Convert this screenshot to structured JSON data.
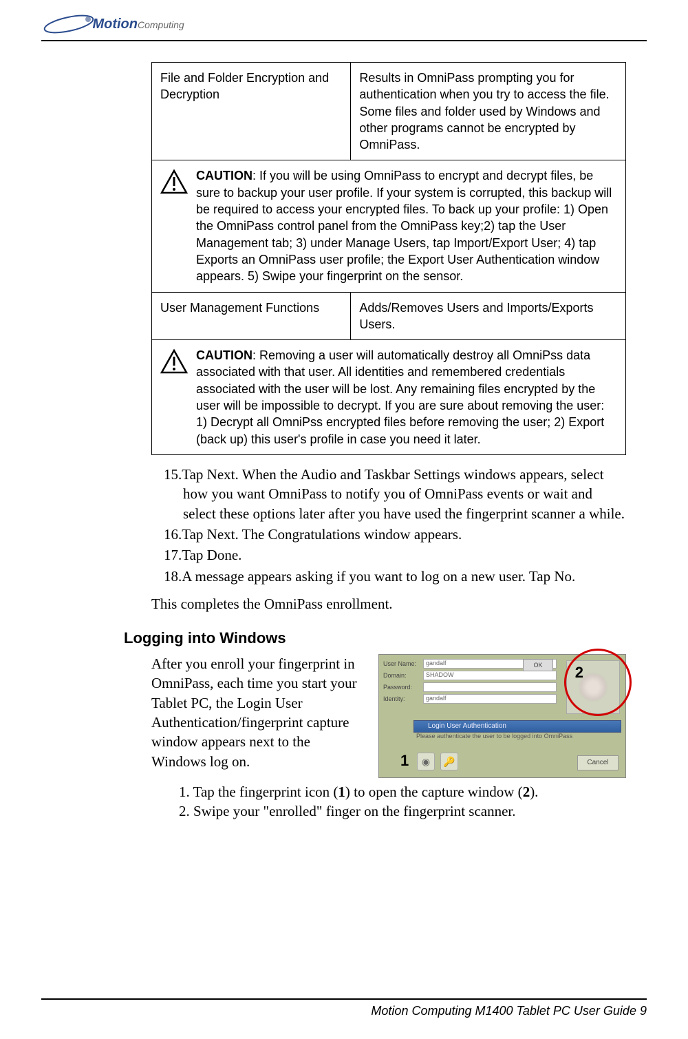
{
  "brand": {
    "name_motion": "Motion",
    "name_computing": "Computing"
  },
  "table": {
    "row1": {
      "left": "File and Folder Encryption and Decryption",
      "right": "Results in OmniPass prompting you for authentication when you try to access the file. Some files and folder used by Windows and other programs cannot be encrypted by OmniPass."
    },
    "caution1": {
      "label": "CAUTION",
      "text": ": If you will be using OmniPass to encrypt and decrypt files, be sure to backup your user profile. If your system is corrupted, this backup will be required to access your encrypted files. To back up your profile: 1) Open the OmniPass control panel from the OmniPass key;2) tap the User Management tab; 3) under Manage Users, tap Import/Export User; 4) tap Exports an OmniPass user profile; the Export User Authentication window appears. 5) Swipe your fingerprint on the sensor."
    },
    "row2": {
      "left": "User Management Functions",
      "right": "Adds/Removes Users and Imports/Exports Users."
    },
    "caution2": {
      "label": "CAUTION",
      "text": ": Removing a user will automatically destroy all OmniPss data associated with that user. All identities and remembered credentials associated with the user will be lost. Any remaining files encrypted by the user will be impossible to decrypt. If you are sure about removing the user: 1) Decrypt all OmniPss encrypted files before removing the user; 2) Export (back up) this user's profile in case you need it later."
    }
  },
  "steps": {
    "s15": "15.Tap Next. When the Audio and Taskbar Settings windows appears, select how you want OmniPass to notify you of OmniPass events or wait and select these options later after you have used the fingerprint scanner a while.",
    "s16": "16.Tap Next. The Congratulations window appears.",
    "s17": "17.Tap Done.",
    "s18": "18.A message appears asking if you want to log on a new user. Tap No."
  },
  "closing": "This completes the OmniPass enrollment.",
  "section_heading": "Logging into Windows",
  "login_para": "After you enroll your fingerprint in OmniPass, each time you start your Tablet PC, the Login User Authentication/fingerprint capture window appears next to the Windows log on.",
  "login_mock": {
    "user_label": "User Name:",
    "user_value": "gandalf",
    "domain_label": "Domain:",
    "domain_value": "SHADOW",
    "password_label": "Password:",
    "identity_label": "Identity:",
    "identity_value": "gandalf",
    "ok": "OK",
    "auth_title": "Login User Authentication",
    "auth_sub": "Please authenticate the user to be logged into OmniPass",
    "cancel": "Cancel"
  },
  "callouts": {
    "num1": "1",
    "num2": "2"
  },
  "sub_steps": {
    "s1a": "1. Tap the fingerprint icon (",
    "s1b": "1",
    "s1c": ") to open the capture window (",
    "s1d": "2",
    "s1e": ").",
    "s2": "2. Swipe your \"enrolled\" finger on the fingerprint scanner."
  },
  "footer": {
    "text": "Motion Computing M1400 Tablet PC User Guide",
    "page": "9"
  }
}
